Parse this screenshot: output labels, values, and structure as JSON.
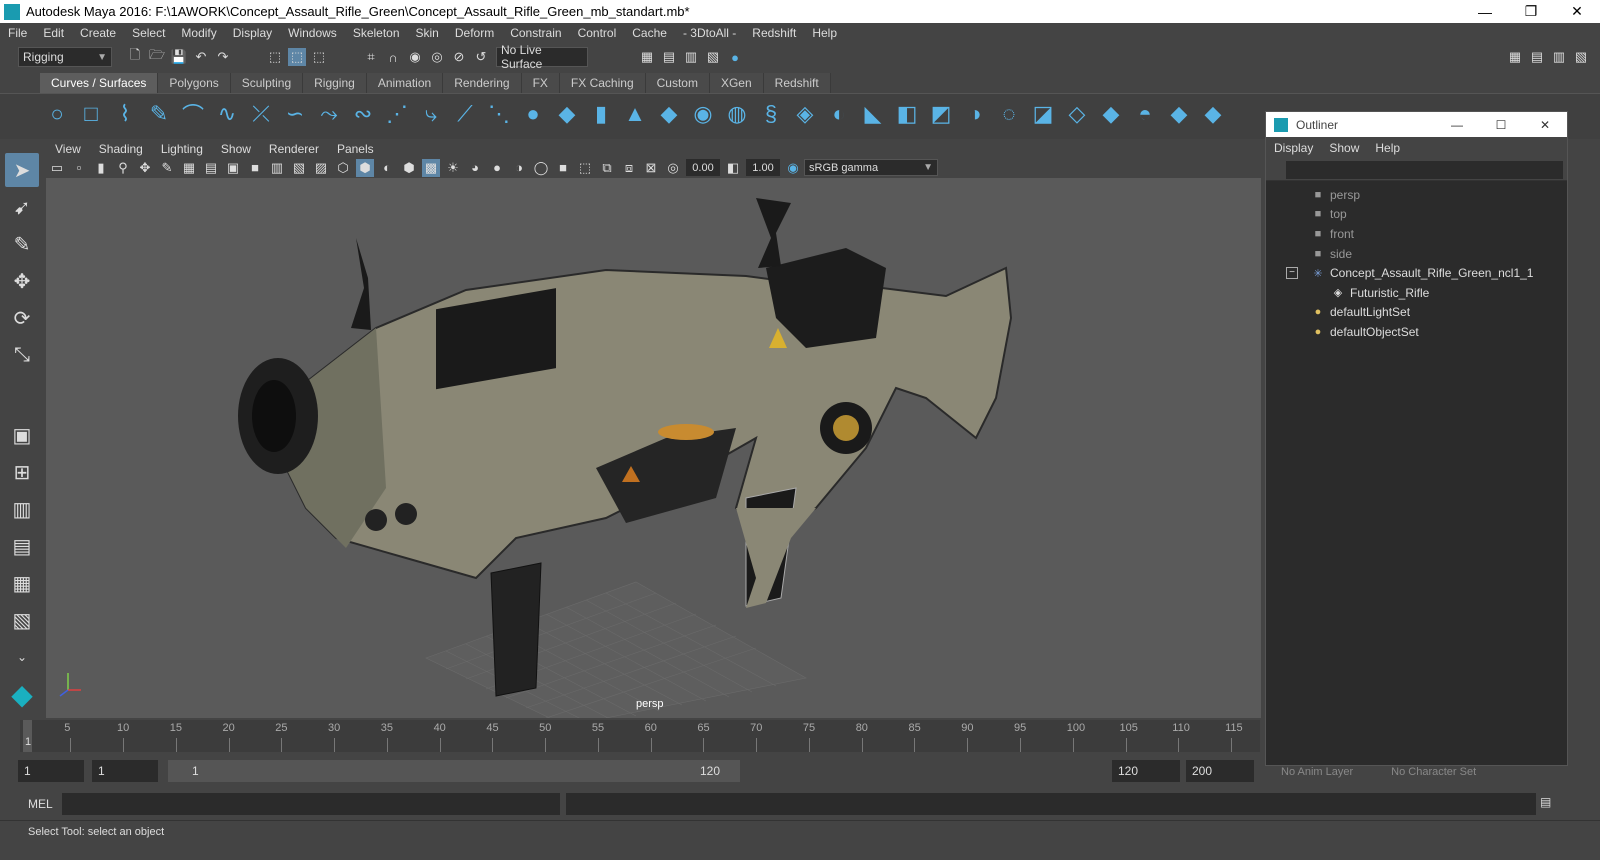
{
  "window": {
    "title": "Autodesk Maya 2016: F:\\1AWORK\\Concept_Assault_Rifle_Green\\Concept_Assault_Rifle_Green_mb_standart.mb*"
  },
  "menubar": [
    "File",
    "Edit",
    "Create",
    "Select",
    "Modify",
    "Display",
    "Windows",
    "Skeleton",
    "Skin",
    "Deform",
    "Constrain",
    "Control",
    "Cache",
    "- 3DtoAll -",
    "Redshift",
    "Help"
  ],
  "statusline": {
    "menuset": "Rigging",
    "live_surface": "No Live Surface"
  },
  "shelf_tabs": [
    "Curves / Surfaces",
    "Polygons",
    "Sculpting",
    "Rigging",
    "Animation",
    "Rendering",
    "FX",
    "FX Caching",
    "Custom",
    "XGen",
    "Redshift"
  ],
  "viewport": {
    "menu": [
      "View",
      "Shading",
      "Lighting",
      "Show",
      "Renderer",
      "Panels"
    ],
    "exposure": "0.00",
    "gamma": "1.00",
    "color_space": "sRGB gamma",
    "camera_label": "persp"
  },
  "outliner": {
    "title": "Outliner",
    "menu": [
      "Display",
      "Show",
      "Help"
    ],
    "items": [
      {
        "label": "persp",
        "icon": "camera-icon",
        "indent": 44,
        "dim": true
      },
      {
        "label": "top",
        "icon": "camera-icon",
        "indent": 44,
        "dim": true
      },
      {
        "label": "front",
        "icon": "camera-icon",
        "indent": 44,
        "dim": true
      },
      {
        "label": "side",
        "icon": "camera-icon",
        "indent": 44,
        "dim": true
      },
      {
        "label": "Concept_Assault_Rifle_Green_ncl1_1",
        "icon": "group-icon",
        "indent": 44,
        "dim": false,
        "expander": "−"
      },
      {
        "label": "Futuristic_Rifle",
        "icon": "mesh-icon",
        "indent": 64,
        "dim": false
      },
      {
        "label": "defaultLightSet",
        "icon": "set-icon",
        "indent": 44,
        "dim": false
      },
      {
        "label": "defaultObjectSet",
        "icon": "set-icon",
        "indent": 44,
        "dim": false
      }
    ],
    "bottom_labels": [
      "No Anim Layer",
      "No Character Set"
    ]
  },
  "timeline": {
    "ticks": [
      "5",
      "10",
      "15",
      "20",
      "25",
      "30",
      "35",
      "40",
      "45",
      "50",
      "55",
      "60",
      "65",
      "70",
      "75",
      "80",
      "85",
      "90",
      "95",
      "100",
      "105",
      "110",
      "115"
    ],
    "current_frame": "1"
  },
  "range": {
    "start": "1",
    "start2": "1",
    "slider_start": "1",
    "slider_end": "120",
    "end": "120",
    "end2": "200"
  },
  "command": {
    "label": "MEL"
  },
  "help_line": "Select Tool: select an object"
}
